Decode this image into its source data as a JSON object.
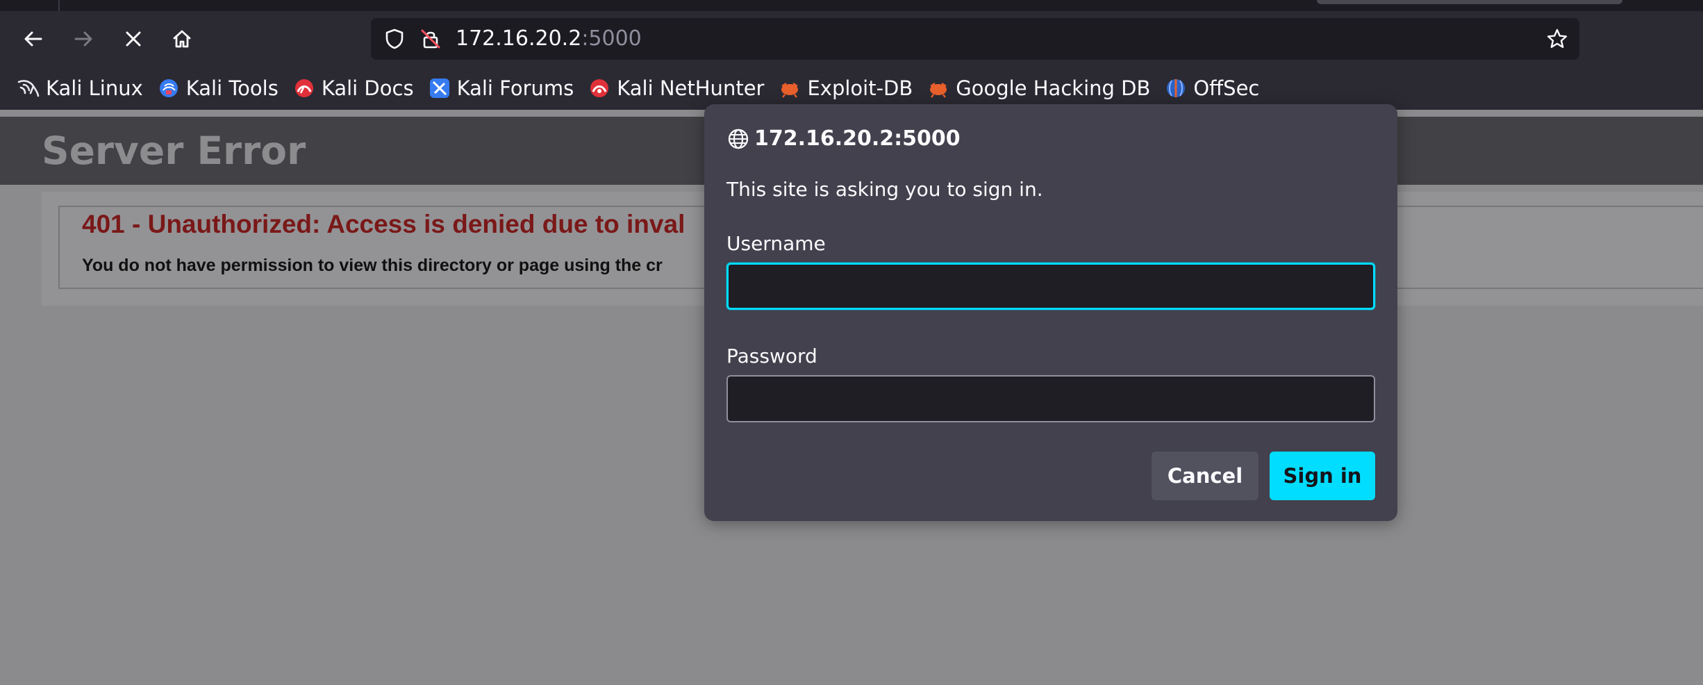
{
  "browser": {
    "url_host": "172.16.20.2",
    "url_port": ":5000"
  },
  "bookmarks": [
    {
      "label": "Kali Linux",
      "icon": "kali-dragon-icon"
    },
    {
      "label": "Kali Tools",
      "icon": "kali-tools-icon"
    },
    {
      "label": "Kali Docs",
      "icon": "kali-docs-icon"
    },
    {
      "label": "Kali Forums",
      "icon": "kali-forums-icon"
    },
    {
      "label": "Kali NetHunter",
      "icon": "kali-nethunter-icon"
    },
    {
      "label": "Exploit-DB",
      "icon": "exploit-db-icon"
    },
    {
      "label": "Google Hacking DB",
      "icon": "google-hacking-db-icon"
    },
    {
      "label": "OffSec",
      "icon": "offsec-icon"
    }
  ],
  "page": {
    "title": "Server Error",
    "error_heading": "401 - Unauthorized: Access is denied due to inval",
    "error_detail": "You do not have permission to view this directory or page using the cr"
  },
  "dialog": {
    "origin": "172.16.20.2:5000",
    "message": "This site is asking you to sign in.",
    "username_label": "Username",
    "username_value": "",
    "password_label": "Password",
    "password_value": "",
    "cancel_label": "Cancel",
    "signin_label": "Sign in"
  },
  "colors": {
    "accent": "#00ddff",
    "toolbar": "#2b2a33",
    "dialog": "#42414d",
    "error_red": "#7a1818"
  }
}
